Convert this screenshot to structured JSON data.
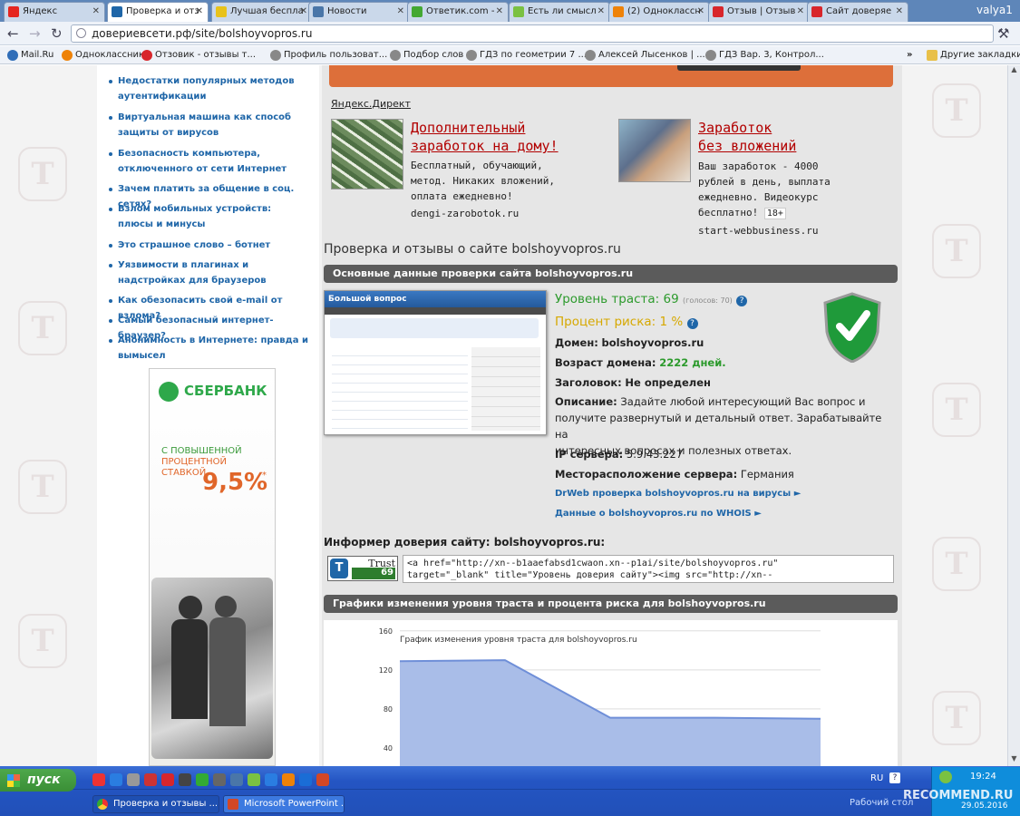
{
  "browser": {
    "tabs": [
      {
        "label": "Яндекс",
        "color": "#e52620"
      },
      {
        "label": "Проверка и отз",
        "color": "#1f66a8"
      },
      {
        "label": "Лучшая беспла",
        "color": "#e8c21a"
      },
      {
        "label": "Новости",
        "color": "#4a76a8"
      },
      {
        "label": "Ответик.com -",
        "color": "#44a832"
      },
      {
        "label": "Есть ли смысл",
        "color": "#7ac142"
      },
      {
        "label": "(2) Одноклассн",
        "color": "#ee8208"
      },
      {
        "label": "Отзыв | Отзыв",
        "color": "#d8262b"
      },
      {
        "label": "Сайт доверяе",
        "color": "#d8262b"
      }
    ],
    "user": "valya1",
    "url": "довериевсети.рф/site/bolshoyvopros.ru",
    "bookmarks": [
      "Mail.Ru",
      "Одноклассники",
      "Отзовик - отзывы т...",
      "Профиль пользоват...",
      "Подбор слов",
      "ГДЗ по геометрии 7 ...",
      "Алексей Лысенков | ...",
      "ГДЗ Вар. 3, Контрол..."
    ],
    "bookmarks_more": "»",
    "other_bookmarks": "Другие закладки"
  },
  "sidebar": {
    "links": [
      "Недостатки популярных методов аутентификации",
      "Виртуальная машина как способ защиты от вирусов",
      "Безопасность компьютера, отключенного от сети Интернет",
      "Зачем платить за общение в соц. сетях?",
      "Взлом мобильных устройств: плюсы и минусы",
      "Это страшное слово – ботнет",
      "Уязвимости в плагинах и надстройках для браузеров",
      "Как обезопасить свой e-mail от взлома?",
      "Самый безопасный интернет-браузер?",
      "Анонимность в Интернете: правда и вымысел"
    ],
    "ad": {
      "brand": "СБЕРБАНК",
      "line1": "С ПОВЫШЕННОЙ",
      "line2": "ПРОЦЕНТНОЙ",
      "line3": "СТАВКОЙ",
      "rate": "9,5%",
      "footnote": "*"
    }
  },
  "direct": {
    "label": "Яндекс.Директ",
    "ad1": {
      "title_line1": "Дополнительный",
      "title_line2": "заработок на дому!",
      "text1": "Бесплатный, обучающий,",
      "text2": "метод. Никаких вложений,",
      "text3": "оплата ежедневно!",
      "domain": "dengi-zarobotok.ru"
    },
    "ad2": {
      "title_line1": "Заработок",
      "title_line2": "без вложений",
      "text1": "Ваш заработок - 4000",
      "text2": "рублей в день, выплата",
      "text3": "ежедневно. Видеокурс",
      "text4": "бесплатно!",
      "age": "18+",
      "domain": "start-webbusiness.ru"
    }
  },
  "site": {
    "heading": "Проверка и отзывы о сайте bolshoyvopros.ru",
    "section1": "Основные данные проверки сайта bolshoyvopros.ru",
    "trust_label": "Уровень траста:",
    "trust_value": "69",
    "votes": "(голосов: 70)",
    "risk_label": "Процент риска:",
    "risk_value": "1 %",
    "domain_label": "Домен:",
    "domain_value": "bolshoyvopros.ru",
    "age_label": "Возраст домена:",
    "age_value": "2222 дней.",
    "title_label": "Заголовок:",
    "title_value": "Не определен",
    "desc_label": "Описание:",
    "desc_line1": "Задайте любой интересующий Вас вопрос и",
    "desc_line2": "получите развернутый и детальный ответ. Зарабатывайте на",
    "desc_line3": "интересных вопросах и полезных ответах.",
    "ip_label": "IP сервера:",
    "ip_value": "5.9.43.227",
    "loc_label": "Месторасположение сервера:",
    "loc_value": "Германия",
    "link_drweb": "DrWeb проверка bolshoyvopros.ru на вирусы ►",
    "link_whois": "Данные о bolshoyvopros.ru по WHOIS ►",
    "thumb_title": "Большой вопрос",
    "informer_title": "Информер доверия сайту: bolshoyvopros.ru:",
    "informer_badge_label": "Trust",
    "informer_badge_value": "69",
    "informer_code1": "<a href=\"http://xn--b1aaefabsd1cwaon.xn--p1ai/site/bolshoyvopros.ru\"",
    "informer_code2": "target=\"_blank\" title=\"Уровень доверия сайту\"><img src=\"http://xn--",
    "section2": "Графики изменения уровня траста и процента риска для bolshoyvopros.ru"
  },
  "chart_data": {
    "type": "area",
    "title": "График изменения уровня траста для bolshoyvopros.ru",
    "yticks": [
      160,
      120,
      80,
      40
    ],
    "ylim": [
      0,
      170
    ],
    "x": [
      0,
      1,
      2,
      3,
      4
    ],
    "values": [
      128,
      129,
      70,
      70,
      69
    ],
    "color": "#a9bde8"
  },
  "taskbar": {
    "start": "пуск",
    "windows": [
      "Проверка и отзывы ...",
      "Microsoft PowerPoint ..."
    ],
    "lang": "RU",
    "desktop": "Рабочий стол",
    "time": "19:24",
    "date": "29.05.2016",
    "watermark": "RECOMMEND.RU"
  }
}
